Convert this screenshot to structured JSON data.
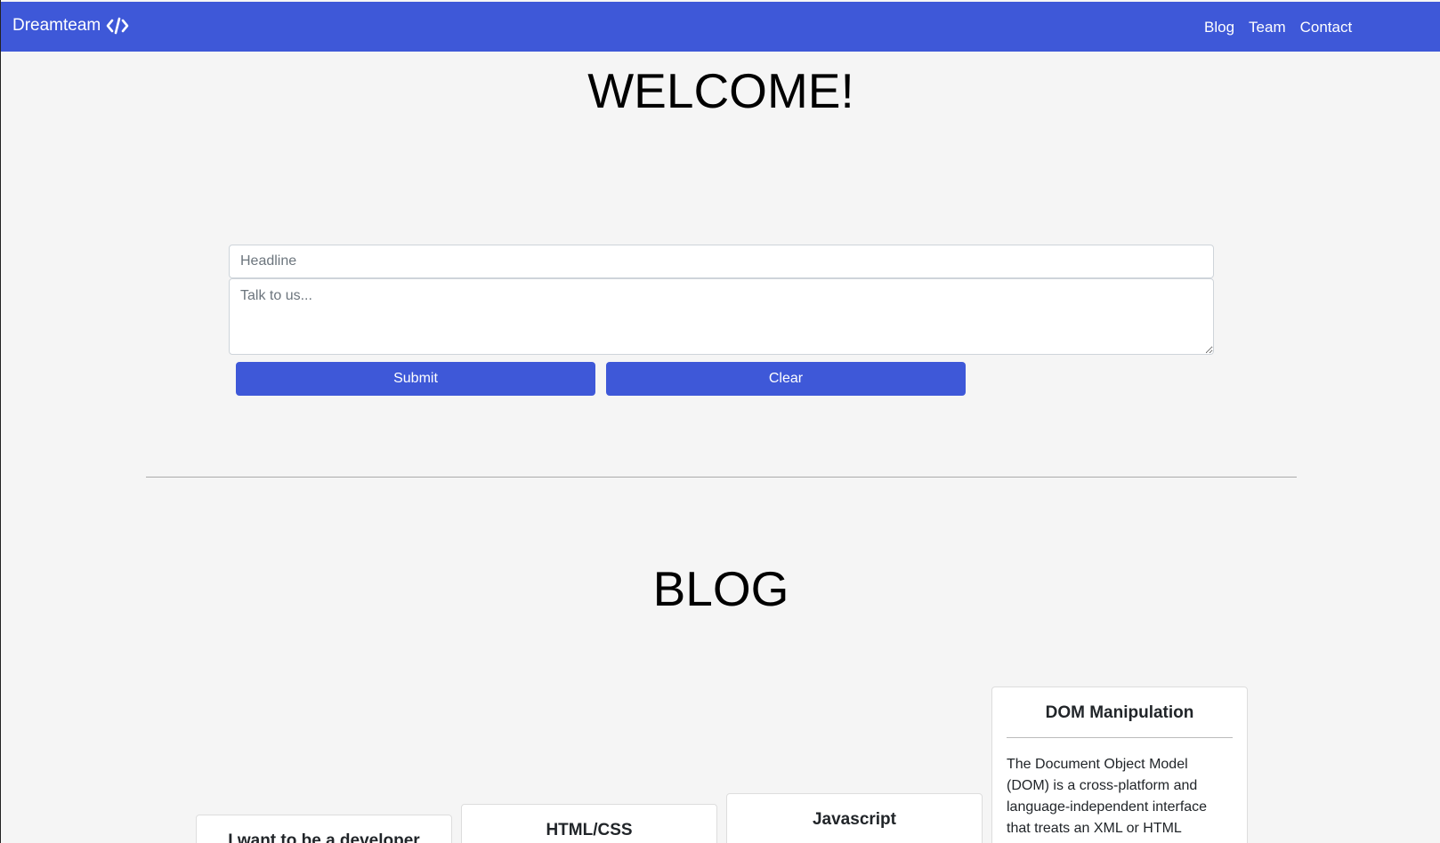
{
  "navbar": {
    "brand": "Dreamteam",
    "brand_icon": "code-icon",
    "links": [
      "Blog",
      "Team",
      "Contact"
    ],
    "color": "#3e58d8"
  },
  "welcome": {
    "title": "WELCOME!"
  },
  "form": {
    "headline_placeholder": "Headline",
    "message_placeholder": "Talk to us...",
    "submit_label": "Submit",
    "clear_label": "Clear"
  },
  "blog": {
    "title": "BLOG",
    "posts": [
      {
        "title": "I want to be a developer",
        "text": ""
      },
      {
        "title": "HTML/CSS",
        "text": ""
      },
      {
        "title": "Javascript",
        "text": ""
      },
      {
        "title": "DOM Manipulation",
        "text": "The Document Object Model (DOM) is a cross-platform and language-independent interface that treats an XML or HTML"
      }
    ]
  }
}
